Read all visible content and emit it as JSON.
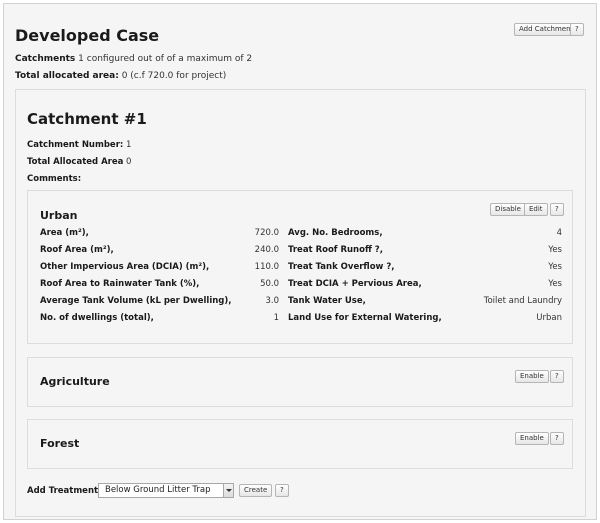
{
  "case": {
    "title": "Developed Case",
    "add_catchment_label": "Add Catchment",
    "help_label": "?",
    "catchments_label": "Catchments",
    "catchments_text": "1 configured out of of a maximum of 2",
    "allocated_label": "Total allocated area:",
    "allocated_text": "0 (c.f 720.0 for project)"
  },
  "catchment": {
    "title": "Catchment #1",
    "number_label": "Catchment Number:",
    "number_value": "1",
    "area_label": "Total Allocated Area",
    "area_value": "0",
    "comments_label": "Comments:"
  },
  "urban": {
    "title": "Urban",
    "disable_label": "Disable",
    "edit_label": "Edit",
    "help_label": "?",
    "rows": [
      {
        "label": "Area (m²),",
        "value": "720.0",
        "label2": "Avg. No. Bedrooms,",
        "value2": "4"
      },
      {
        "label": "Roof Area (m²),",
        "value": "240.0",
        "label2": "Treat Roof Runoff ?,",
        "value2": "Yes"
      },
      {
        "label": "Other Impervious Area (DCIA) (m²),",
        "value": "110.0",
        "label2": "Treat Tank Overflow ?,",
        "value2": "Yes"
      },
      {
        "label": "Roof Area to Rainwater Tank (%),",
        "value": "50.0",
        "label2": "Treat DCIA + Pervious Area,",
        "value2": "Yes"
      },
      {
        "label": "Average Tank Volume (kL per Dwelling),",
        "value": "3.0",
        "label2": "Tank Water Use,",
        "value2": "Toilet and Laundry"
      },
      {
        "label": "No. of dwellings (total),",
        "value": "1",
        "label2": "Land Use for External Watering,",
        "value2": "Urban"
      }
    ]
  },
  "agriculture": {
    "title": "Agriculture",
    "enable_label": "Enable",
    "help_label": "?"
  },
  "forest": {
    "title": "Forest",
    "enable_label": "Enable",
    "help_label": "?"
  },
  "treatment": {
    "label": "Add Treatment",
    "selected": "Below Ground Litter Trap",
    "create_label": "Create",
    "help_label": "?"
  }
}
